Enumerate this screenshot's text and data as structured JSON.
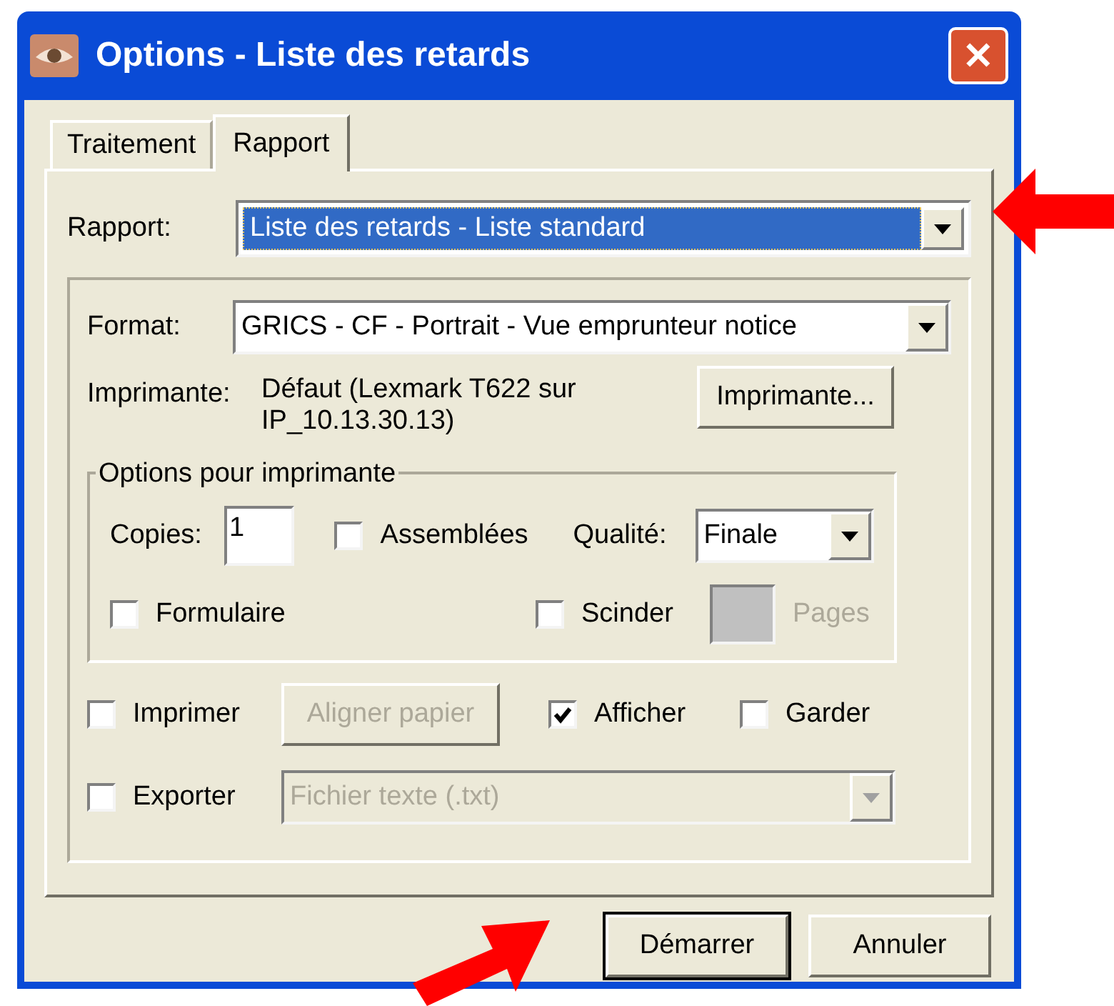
{
  "window": {
    "title": "Options - Liste des retards",
    "close": "✕"
  },
  "tabs": [
    {
      "label": "Traitement",
      "selected": false
    },
    {
      "label": "Rapport",
      "selected": true
    }
  ],
  "rapport": {
    "label": "Rapport:",
    "value": "Liste des retards - Liste standard",
    "focused": true
  },
  "format": {
    "label": "Format:",
    "value": "GRICS - CF - Portrait - Vue emprunteur notice"
  },
  "printer": {
    "label": "Imprimante:",
    "value_lines": [
      "Défaut (Lexmark T622 sur",
      "IP_10.13.30.13)"
    ],
    "button": "Imprimante..."
  },
  "printer_options": {
    "legend": "Options pour imprimante",
    "copies_label": "Copies:",
    "copies_value": "1",
    "assemblees": {
      "label": "Assemblées",
      "checked": false
    },
    "quality_label": "Qualité:",
    "quality_value": "Finale",
    "formulaire": {
      "label": "Formulaire",
      "checked": false
    },
    "scinder": {
      "label": "Scinder",
      "checked": false
    },
    "pages_label": "Pages",
    "pages_disabled": true
  },
  "imprimer": {
    "label": "Imprimer",
    "checked": false
  },
  "aligner": {
    "label": "Aligner papier",
    "disabled": true
  },
  "afficher": {
    "label": "Afficher",
    "checked": true
  },
  "garder": {
    "label": "Garder",
    "checked": false
  },
  "exporter": {
    "label": "Exporter",
    "checked": false
  },
  "export_format": {
    "value": "Fichier texte (.txt)",
    "disabled": true
  },
  "buttons": [
    {
      "label": "Démarrer",
      "default": true
    },
    {
      "label": "Annuler",
      "default": false
    }
  ]
}
